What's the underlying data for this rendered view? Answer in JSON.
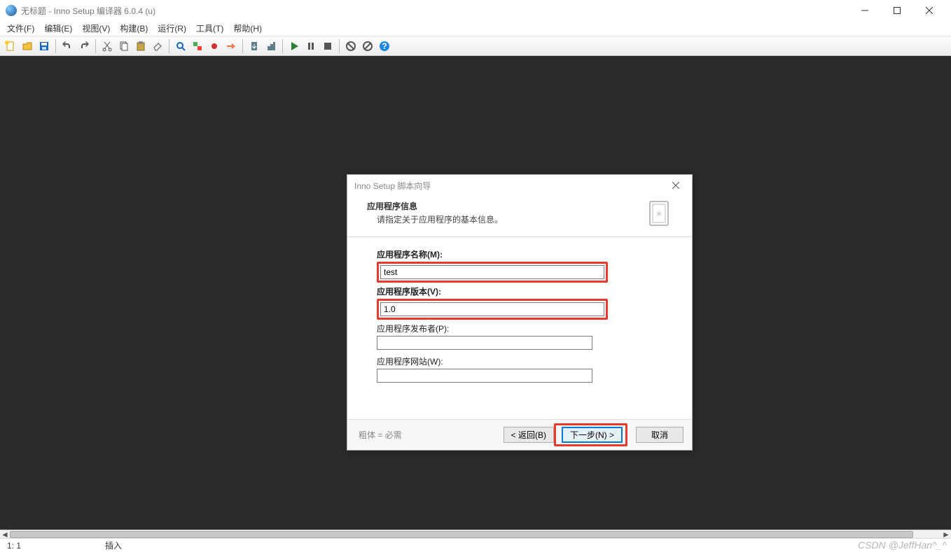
{
  "window": {
    "title": "无标题 - Inno Setup 编译器 6.0.4 (u)"
  },
  "menu": {
    "file": "文件(F)",
    "edit": "编辑(E)",
    "view": "视图(V)",
    "build": "构建(B)",
    "run": "运行(R)",
    "tools": "工具(T)",
    "help": "帮助(H)"
  },
  "status": {
    "position": "1:   1",
    "mode": "插入"
  },
  "watermark": "CSDN @JeffHan^_^",
  "dialog": {
    "title": "Inno Setup 脚本向导",
    "heading": "应用程序信息",
    "subheading": "请指定关于应用程序的基本信息。",
    "labels": {
      "name": "应用程序名称(M):",
      "version": "应用程序版本(V):",
      "publisher": "应用程序发布者(P):",
      "website": "应用程序网站(W):"
    },
    "values": {
      "name": "test",
      "version": "1.0",
      "publisher": "",
      "website": ""
    },
    "required_note": "粗体 = 必需",
    "buttons": {
      "back": "< 返回(B)",
      "next": "下一步(N) >",
      "cancel": "取消"
    }
  }
}
